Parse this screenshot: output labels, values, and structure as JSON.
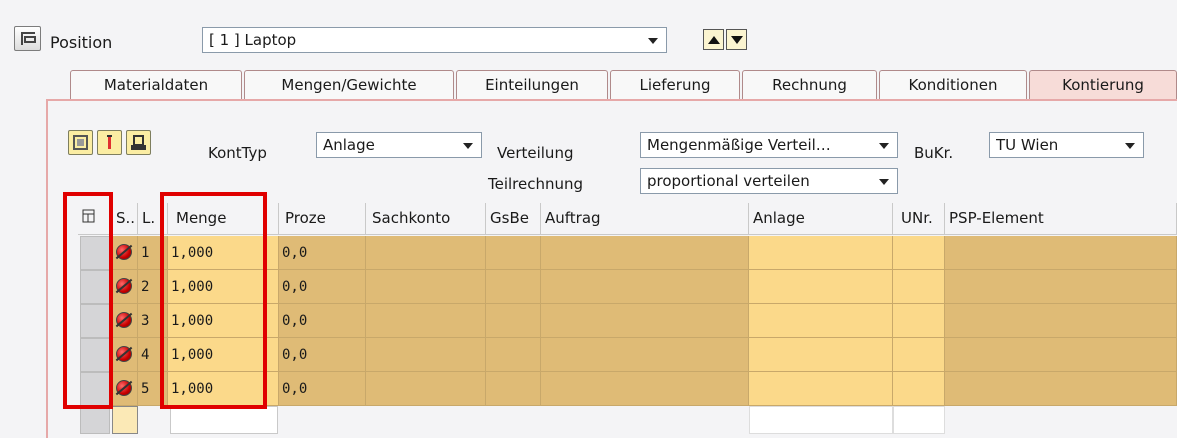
{
  "position": {
    "label": "Position",
    "selected": "[ 1 ] Laptop"
  },
  "tabs": [
    {
      "label": "Materialdaten"
    },
    {
      "label": "Mengen/Gewichte"
    },
    {
      "label": "Einteilungen"
    },
    {
      "label": "Lieferung"
    },
    {
      "label": "Rechnung"
    },
    {
      "label": "Konditionen"
    },
    {
      "label": "Kontierung"
    }
  ],
  "form": {
    "kont_typ_label": "KontTyp",
    "kont_typ_value": "Anlage",
    "verteilung_label": "Verteilung",
    "verteilung_value": "Mengenmäßige Verteil…",
    "bukr_label": "BuKr.",
    "bukr_value": "TU Wien",
    "teilrechnung_label": "Teilrechnung",
    "teilrechnung_value": "proportional verteilen"
  },
  "grid": {
    "columns": [
      "S..",
      "L.",
      "Menge",
      "Proze",
      "Sachkonto",
      "GsBe",
      "Auftrag",
      "Anlage",
      "UNr.",
      "PSP-Element"
    ],
    "rows": [
      {
        "line": "1",
        "menge": "1,000",
        "proze": "0,0"
      },
      {
        "line": "2",
        "menge": "1,000",
        "proze": "0,0"
      },
      {
        "line": "3",
        "menge": "1,000",
        "proze": "0,0"
      },
      {
        "line": "4",
        "menge": "1,000",
        "proze": "0,0"
      },
      {
        "line": "5",
        "menge": "1,000",
        "proze": "0,0"
      }
    ]
  },
  "colors": {
    "row_dark": "#dfbb76",
    "row_light": "#fbd98a",
    "highlight": "#e00000",
    "active_tab": "#f7dcd8"
  }
}
